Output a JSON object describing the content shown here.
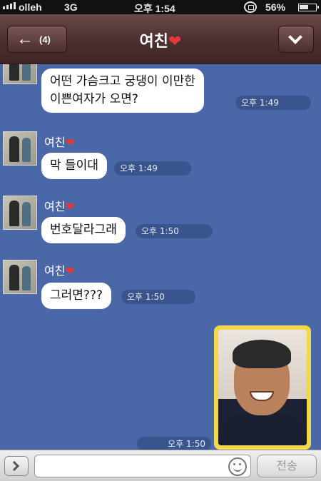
{
  "status_bar": {
    "carrier": "olleh",
    "network": "3G",
    "time": "오후 1:54",
    "battery": "56%"
  },
  "header": {
    "back_count": "(4)",
    "title": "여친",
    "title_heart": "❤"
  },
  "messages": [
    {
      "sender": "",
      "text": "어떤 가슴크고 궁댕이 이만한\n이쁜여자가 오면?",
      "time": "오후 1:49"
    },
    {
      "sender": "여친",
      "heart": "❤",
      "text": "막 들이대",
      "time": "오후 1:49"
    },
    {
      "sender": "여친",
      "heart": "❤",
      "text": "번호달라그래",
      "time": "오후 1:50"
    },
    {
      "sender": "여친",
      "heart": "❤",
      "text": "그러면???",
      "time": "오후 1:50"
    }
  ],
  "sent_photo": {
    "time": "오후 1:50"
  },
  "input_bar": {
    "send_label": "전송"
  },
  "colors": {
    "chat_bg": "#4a68a8",
    "header_bg": "#4e3030",
    "photo_frame": "#f0d84a"
  }
}
